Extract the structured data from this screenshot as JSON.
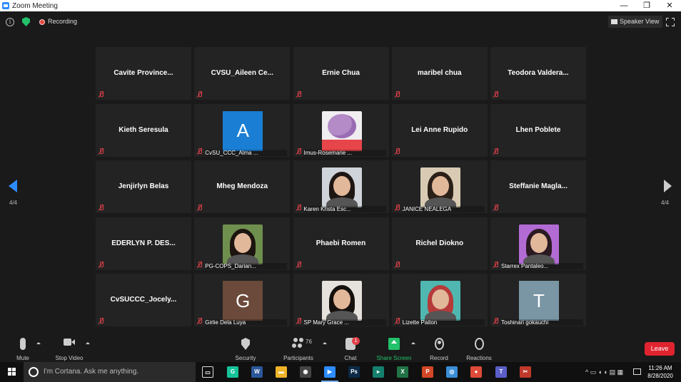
{
  "window": {
    "title": "Zoom Meeting",
    "controls": [
      "—",
      "❐",
      "✕"
    ]
  },
  "topbar": {
    "recording_label": "Recording",
    "view_label": "Speaker View"
  },
  "pagination": {
    "left": "4/4",
    "right": "4/4"
  },
  "participants": [
    {
      "name": "Cavite Province...",
      "type": "name"
    },
    {
      "name": "CVSU_Aileen Ce...",
      "type": "name"
    },
    {
      "name": "Ernie Chua",
      "type": "name"
    },
    {
      "name": "maribel chua",
      "type": "name"
    },
    {
      "name": "Teodora Valdera...",
      "type": "name"
    },
    {
      "name": "Kieth Seresula",
      "type": "name"
    },
    {
      "label": "CvSU_CCC_Alma ...",
      "type": "avatar",
      "letter": "A",
      "color": "#1a7fd4"
    },
    {
      "label": "Imus-Rosemarie ...",
      "type": "rose"
    },
    {
      "name": "Lei Anne Rupido",
      "type": "name"
    },
    {
      "name": "Lhen Poblete",
      "type": "name"
    },
    {
      "name": "Jenjirlyn Belas",
      "type": "name"
    },
    {
      "name": "Mheg Mendoza",
      "type": "name"
    },
    {
      "label": "Karen Krista Esc...",
      "type": "photo",
      "bg": "#cfd3da",
      "hair": "#1e1612"
    },
    {
      "label": "JANICE NEALEGA",
      "type": "photo",
      "bg": "#d9cbb3",
      "hair": "#2a2018"
    },
    {
      "name": "Steffanie Magla...",
      "type": "name"
    },
    {
      "name": "EDERLYN P. DES...",
      "type": "name"
    },
    {
      "label": "PG-COPS_Darian...",
      "type": "photo",
      "bg": "#6f8f4e",
      "hair": "#1c140f"
    },
    {
      "name": "Phaebi Romen",
      "type": "name"
    },
    {
      "name": "Richel Diokno",
      "type": "name"
    },
    {
      "label": "Starrex Pantaleo...",
      "type": "photo",
      "bg": "#b36bd4",
      "hair": "#2b1a22"
    },
    {
      "name": "CvSUCCC_Jocely...",
      "type": "name"
    },
    {
      "label": "Girlie Dela Luya",
      "type": "avatar",
      "letter": "G",
      "color": "#6b4a3b"
    },
    {
      "label": "SP Mary Grace ...",
      "type": "photo",
      "bg": "#e5e1dc",
      "hair": "#15110e"
    },
    {
      "label": "Lizette Paiton",
      "type": "photo",
      "bg": "#4fb7b0",
      "hair": "#b63a3a"
    },
    {
      "label": "Toshinari gokauchi",
      "type": "avatar",
      "letter": "T",
      "color": "#7a95a4"
    }
  ],
  "toolbar": {
    "mute": "Mute",
    "stop_video": "Stop Video",
    "security": "Security",
    "participants": "Participants",
    "participants_count": "76",
    "chat": "Chat",
    "chat_badge": "1",
    "share_screen": "Share Screen",
    "record": "Record",
    "reactions": "Reactions",
    "leave": "Leave"
  },
  "taskbar": {
    "cortana_placeholder": "I'm Cortana. Ask me anything.",
    "apps": [
      {
        "name": "task-view-icon",
        "glyph": "▭",
        "color": "transparent"
      },
      {
        "name": "grammarly-icon",
        "glyph": "G",
        "color": "#15c39a"
      },
      {
        "name": "word-icon",
        "glyph": "W",
        "color": "#2b579a"
      },
      {
        "name": "file-explorer-icon",
        "glyph": "▬",
        "color": "#f0b429"
      },
      {
        "name": "camera-app-icon",
        "glyph": "◉",
        "color": "#444444"
      },
      {
        "name": "zoom-app-icon",
        "glyph": "▶",
        "color": "#2d8cff"
      },
      {
        "name": "photoshop-icon",
        "glyph": "Ps",
        "color": "#0b2a47"
      },
      {
        "name": "sway-icon",
        "glyph": "▸",
        "color": "#14806e"
      },
      {
        "name": "excel-icon",
        "glyph": "X",
        "color": "#217346"
      },
      {
        "name": "powerpoint-icon",
        "glyph": "P",
        "color": "#d24726"
      },
      {
        "name": "maps-icon",
        "glyph": "◎",
        "color": "#3a8ed6"
      },
      {
        "name": "chrome-icon",
        "glyph": "●",
        "color": "#dd4b39"
      },
      {
        "name": "teams-icon",
        "glyph": "T",
        "color": "#5b5fc7"
      },
      {
        "name": "snipping-tool-icon",
        "glyph": "✂",
        "color": "#c0392b"
      }
    ],
    "tray_icons": "^ ▭ ◖ ◗ ▤ ▦",
    "time": "11:26 AM",
    "date": "8/28/2020"
  }
}
